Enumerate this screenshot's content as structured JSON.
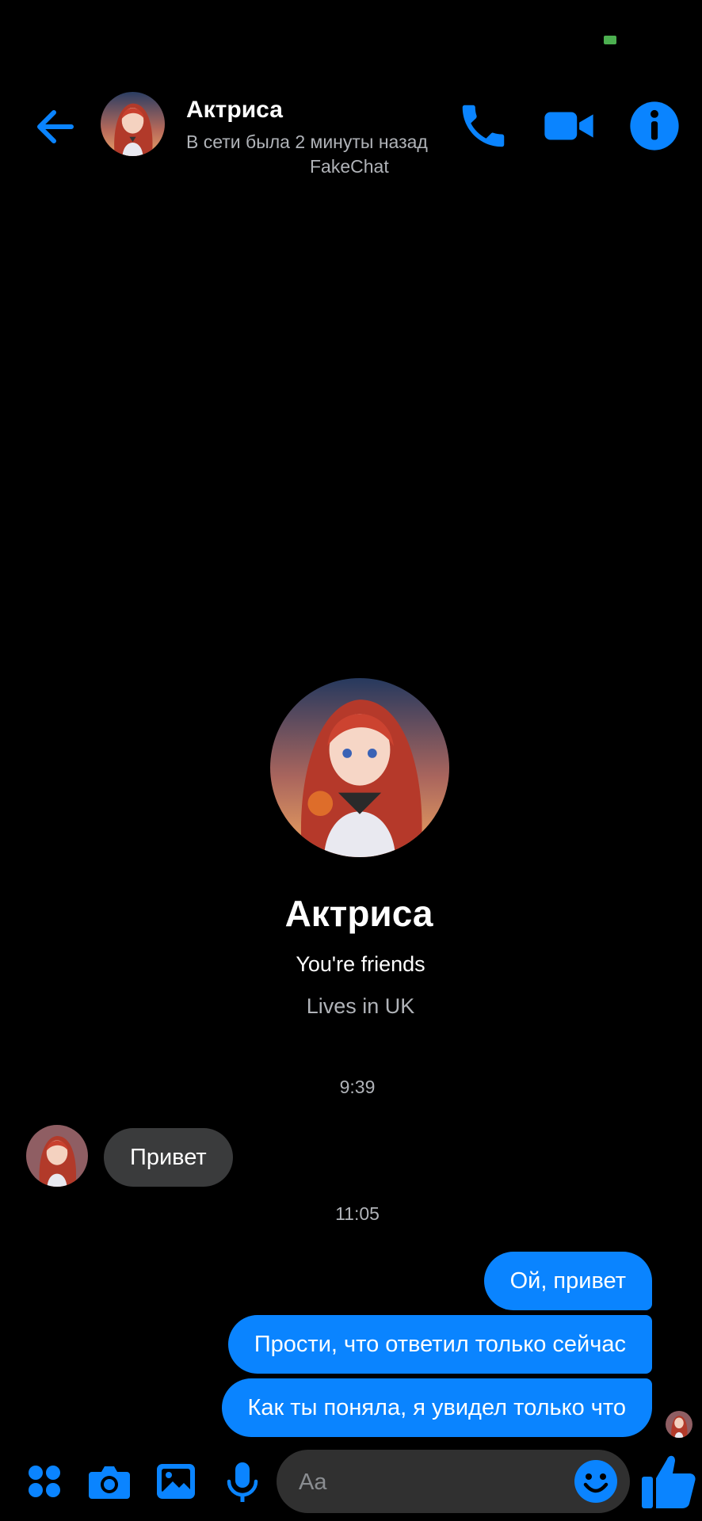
{
  "colors": {
    "accent": "#0a84ff",
    "background": "#000000",
    "incoming_bubble": "#3a3b3c",
    "secondary_text": "#b0b3b8",
    "input_background": "#303030"
  },
  "header": {
    "back_icon": "arrow-left-icon",
    "contact_name": "Актриса",
    "status": "В сети была 2 минуты назад",
    "app_label": "FakeChat",
    "call_icon": "phone-icon",
    "video_icon": "video-camera-icon",
    "info_icon": "info-icon"
  },
  "profile": {
    "name": "Актриса",
    "relationship": "You're friends",
    "location": "Lives in UK"
  },
  "messages": {
    "timestamp_1": "9:39",
    "incoming": [
      {
        "text": "Привет"
      }
    ],
    "timestamp_2": "11:05",
    "outgoing": [
      {
        "text": "Ой, привет"
      },
      {
        "text": "Прости, что ответил только сейчас"
      },
      {
        "text": "Как ты поняла, я увидел только что"
      }
    ]
  },
  "composer": {
    "apps_icon": "apps-grid-icon",
    "camera_icon": "camera-icon",
    "gallery_icon": "image-icon",
    "mic_icon": "microphone-icon",
    "placeholder": "Aa",
    "emoji_icon": "smiley-icon",
    "like_icon": "thumbs-up-icon"
  }
}
